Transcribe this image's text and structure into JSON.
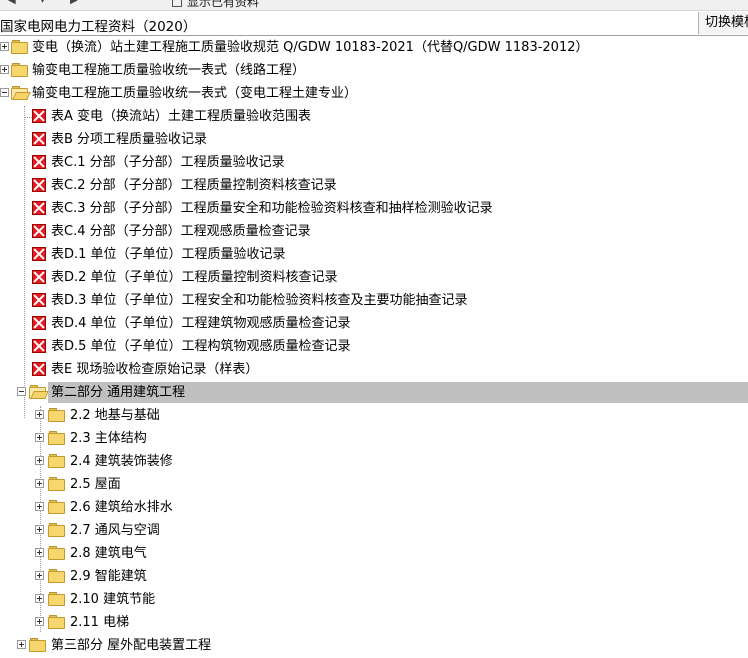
{
  "toolbar": {
    "partial_label": "显示已有资料"
  },
  "header": {
    "title": "国家电网电力工程资料（2020）",
    "switch_button": "切换模板"
  },
  "tree": {
    "n0": "变电（换流）站土建工程施工质量验收规范 Q/GDW 10183-2021（代替Q/GDW 1183-2012）",
    "n1": "输变电工程施工质量验收统一表式（线路工程）",
    "n2": "输变电工程施工质量验收统一表式（变电工程土建专业）",
    "n3": "表A 变电（换流站）土建工程质量验收范围表",
    "n4": "表B 分项工程质量验收记录",
    "n5": "表C.1 分部（子分部）工程质量验收记录",
    "n6": "表C.2 分部（子分部）工程质量控制资料核查记录",
    "n7": "表C.3 分部（子分部）工程质量安全和功能检验资料核查和抽样检测验收记录",
    "n8": "表C.4 分部（子分部）工程观感质量检查记录",
    "n9": "表D.1 单位（子单位）工程质量验收记录",
    "n10": "表D.2 单位（子单位）工程质量控制资料核查记录",
    "n11": "表D.3 单位（子单位）工程安全和功能检验资料核查及主要功能抽查记录",
    "n12": "表D.4 单位（子单位）工程建筑物观感质量检查记录",
    "n13": "表D.5 单位（子单位）工程构筑物观感质量检查记录",
    "n14": "表E 现场验收检查原始记录（样表）",
    "n15": "第二部分 通用建筑工程",
    "n16": "2.2 地基与基础",
    "n17": "2.3 主体结构",
    "n18": "2.4 建筑装饰装修",
    "n19": "2.5 屋面",
    "n20": "2.6 建筑给水排水",
    "n21": "2.7 通风与空调",
    "n22": "2.8 建筑电气",
    "n23": "2.9 智能建筑",
    "n24": "2.10 建筑节能",
    "n25": "2.11 电梯",
    "n26": "第三部分 屋外配电装置工程"
  }
}
